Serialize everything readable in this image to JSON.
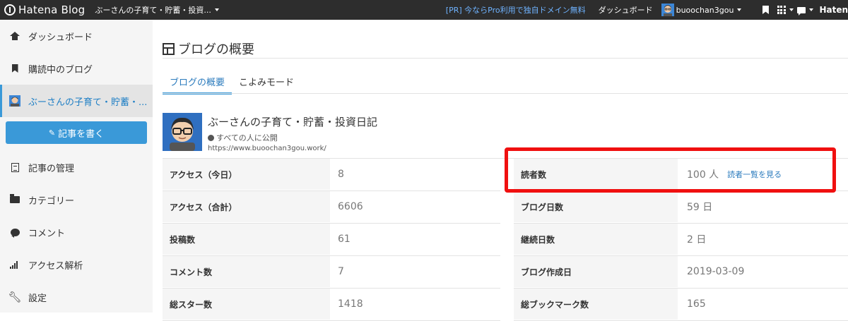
{
  "topbar": {
    "logo_text": "Hatena Blog",
    "blog_selector": "ぶーさんの子育て・貯蓄・投資...",
    "promo": "[PR] 今ならPro利用で独自ドメイン無料",
    "dashboard": "ダッシュボード",
    "username": "buoochan3gou",
    "hatena_cut": "Haten",
    "icons": [
      "bookmark-icon",
      "apps-grid-icon",
      "notification-icon",
      "hatena-logo-icon"
    ]
  },
  "sidebar": {
    "items": [
      {
        "label": "ダッシュボード",
        "icon": "home-icon"
      },
      {
        "label": "購読中のブログ",
        "icon": "bookmark-icon"
      },
      {
        "label": "ぶーさんの子育て・貯蓄・...",
        "icon": "blog-avatar-icon"
      },
      {
        "label": "記事の管理",
        "icon": "document-icon"
      },
      {
        "label": "カテゴリー",
        "icon": "folder-icon"
      },
      {
        "label": "コメント",
        "icon": "comment-icon"
      },
      {
        "label": "アクセス解析",
        "icon": "chart-bars-icon"
      },
      {
        "label": "設定",
        "icon": "wrench-icon"
      }
    ],
    "write_button": "記事を書く"
  },
  "main": {
    "page_title": "ブログの概要",
    "tabs": [
      {
        "label": "ブログの概要",
        "active": true
      },
      {
        "label": "こよみモード",
        "active": false
      }
    ],
    "blog": {
      "name": "ぶーさんの子育て・貯蓄・投資日記",
      "visibility": "すべての人に公開",
      "url": "https://www.buoochan3gou.work/"
    },
    "stats_left": [
      {
        "label": "アクセス（今日）",
        "value": "8"
      },
      {
        "label": "アクセス（合計）",
        "value": "6606"
      },
      {
        "label": "投稿数",
        "value": "61"
      },
      {
        "label": "コメント数",
        "value": "7"
      },
      {
        "label": "総スター数",
        "value": "1418"
      }
    ],
    "stats_right": [
      {
        "label": "読者数",
        "value": "100 人",
        "link": "読者一覧を見る"
      },
      {
        "label": "ブログ日数",
        "value": "59 日"
      },
      {
        "label": "継続日数",
        "value": "2 日"
      },
      {
        "label": "ブログ作成日",
        "value": "2019-03-09"
      },
      {
        "label": "総ブックマーク数",
        "value": "165"
      }
    ]
  },
  "colors": {
    "topbar": "#2d2d2d",
    "accent": "#3a99d8",
    "link": "#2b7bbd",
    "promo": "#6fb3ff",
    "highlight": "#f01010"
  }
}
